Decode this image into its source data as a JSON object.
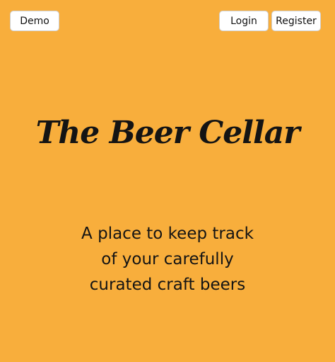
{
  "nav": {
    "demo_label": "Demo",
    "login_label": "Login",
    "register_label": "Register"
  },
  "hero": {
    "title": "The Beer Cellar",
    "tagline": "A place to keep track of your carefully curated craft beers"
  },
  "colors": {
    "background": "#f8ae3c",
    "button_bg": "#ffffff",
    "text": "#141414"
  }
}
